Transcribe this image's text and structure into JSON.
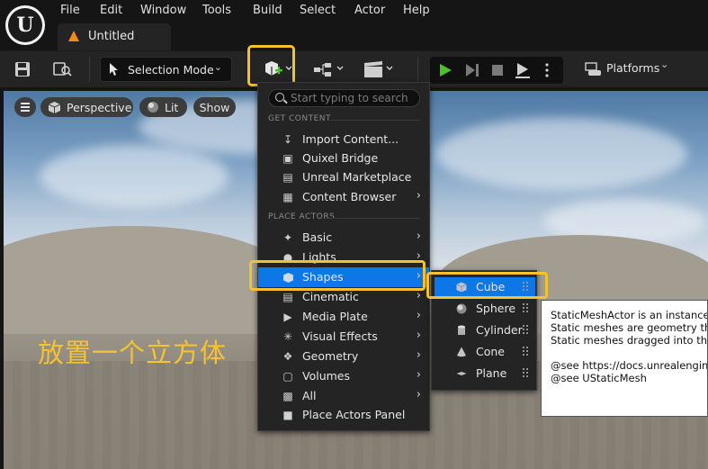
{
  "menubar": {
    "items": [
      "File",
      "Edit",
      "Window",
      "Tools",
      "Build",
      "Select",
      "Actor",
      "Help"
    ],
    "doc_tab": "Untitled"
  },
  "toolbar": {
    "selection_mode": "Selection Mode",
    "platforms": "Platforms"
  },
  "viewport": {
    "perspective": "Perspective",
    "lit": "Lit",
    "show": "Show",
    "caption": "放置一个立方体"
  },
  "add_menu": {
    "search_placeholder": "Start typing to search",
    "sections": [
      "GET CONTENT",
      "PLACE ACTORS"
    ],
    "get_content": [
      {
        "label": "Import Content...",
        "icon": "import-icon",
        "has_submenu": false
      },
      {
        "label": "Quixel Bridge",
        "icon": "quixel-icon",
        "has_submenu": false
      },
      {
        "label": "Unreal Marketplace",
        "icon": "marketplace-icon",
        "has_submenu": false
      },
      {
        "label": "Content Browser",
        "icon": "content-browser-icon",
        "has_submenu": true
      }
    ],
    "place_actors": [
      {
        "label": "Basic",
        "icon": "basic-icon",
        "has_submenu": true
      },
      {
        "label": "Lights",
        "icon": "light-icon",
        "has_submenu": true
      },
      {
        "label": "Shapes",
        "icon": "shapes-icon",
        "has_submenu": true,
        "active": true
      },
      {
        "label": "Cinematic",
        "icon": "cinematic-icon",
        "has_submenu": true
      },
      {
        "label": "Media Plate",
        "icon": "media-plate-icon",
        "has_submenu": true
      },
      {
        "label": "Visual Effects",
        "icon": "visual-effects-icon",
        "has_submenu": true
      },
      {
        "label": "Geometry",
        "icon": "geometry-icon",
        "has_submenu": true
      },
      {
        "label": "Volumes",
        "icon": "volumes-icon",
        "has_submenu": true
      },
      {
        "label": "All",
        "icon": "all-icon",
        "has_submenu": true
      },
      {
        "label": "Place Actors Panel",
        "icon": "place-actors-panel-icon",
        "has_submenu": false
      }
    ]
  },
  "shapes_menu": {
    "items": [
      {
        "label": "Cube",
        "active": true
      },
      {
        "label": "Sphere"
      },
      {
        "label": "Cylinder"
      },
      {
        "label": "Cone"
      },
      {
        "label": "Plane"
      }
    ]
  },
  "tooltip": {
    "lines": [
      "StaticMeshActor is an instance o",
      "Static meshes are geometry that",
      "Static meshes dragged into the le",
      "",
      "@see https://docs.unrealengine.",
      "@see UStaticMesh"
    ]
  },
  "colors": {
    "accent_blue": "#0d77e8",
    "highlight_yellow": "#f3c22c",
    "play_green": "#4fbf2f",
    "caption_yellow": "#f4c32e"
  }
}
